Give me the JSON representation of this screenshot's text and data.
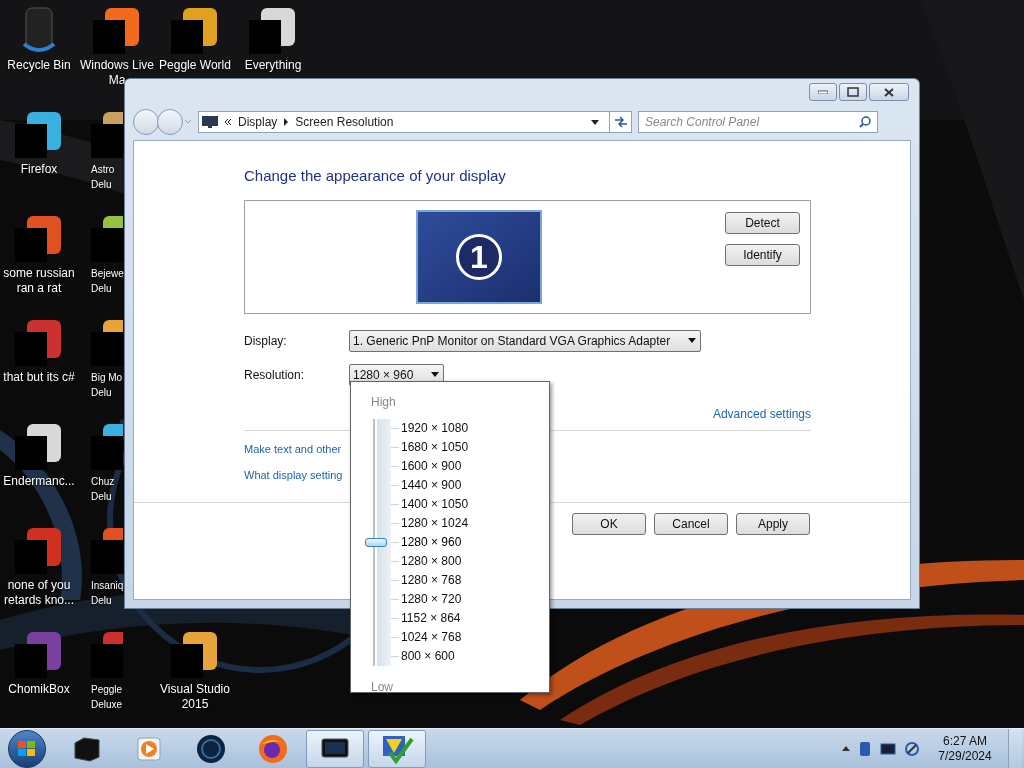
{
  "desktop_rows": [
    [
      {
        "label": "Recycle Bin",
        "kind": "bin"
      },
      {
        "label": "Windows Live Ma",
        "kind": "app"
      },
      {
        "label": "Peggle World",
        "kind": "app"
      },
      {
        "label": "Everything",
        "kind": "app"
      }
    ],
    [
      {
        "label": "Firefox",
        "kind": "app"
      },
      {
        "label": "Astro Delu",
        "kind": "app"
      }
    ],
    [
      {
        "label": "some russian ran a rat",
        "kind": "app"
      },
      {
        "label": "Bejewe Delu",
        "kind": "app"
      }
    ],
    [
      {
        "label": "that but its c#",
        "kind": "app"
      },
      {
        "label": "Big Mo Delu",
        "kind": "app"
      }
    ],
    [
      {
        "label": "Endermanc...",
        "kind": "app"
      },
      {
        "label": "Chuz Delu",
        "kind": "app"
      }
    ],
    [
      {
        "label": "none of you retards kno...",
        "kind": "app"
      },
      {
        "label": "Insaniq Delu",
        "kind": "app"
      }
    ],
    [
      {
        "label": "ChomikBox",
        "kind": "app"
      },
      {
        "label": "Peggle Deluxe",
        "kind": "app"
      },
      {
        "label": "Visual Studio 2015",
        "kind": "app"
      }
    ]
  ],
  "window": {
    "address_bar": {
      "crumbs": [
        "Display",
        "Screen Resolution"
      ]
    },
    "search": {
      "placeholder": "Search Control Panel"
    },
    "heading": "Change the appearance of your display",
    "monitor": {
      "number": "1"
    },
    "side_buttons": [
      "Detect",
      "Identify"
    ],
    "fields": [
      {
        "label": "Display:",
        "value": "1. Generic PnP Monitor on Standard VGA Graphics Adapter"
      },
      {
        "label": "Resolution:",
        "value": "1280 × 960"
      }
    ],
    "advanced_link": "Advanced settings",
    "links": [
      "Make text and other",
      "What display setting"
    ],
    "dialog_buttons": [
      "OK",
      "Cancel",
      "Apply"
    ]
  },
  "resolution_menu": {
    "high_label": "High",
    "low_label": "Low",
    "options": [
      {
        "label": "1920 × 1080",
        "selected": false
      },
      {
        "label": "1680 × 1050",
        "selected": false
      },
      {
        "label": "1600 × 900",
        "selected": false
      },
      {
        "label": "1440 × 900",
        "selected": false
      },
      {
        "label": "1400 × 1050",
        "selected": false
      },
      {
        "label": "1280 × 1024",
        "selected": false
      },
      {
        "label": "1280 × 960",
        "selected": true
      },
      {
        "label": "1280 × 800",
        "selected": false
      },
      {
        "label": "1280 × 768",
        "selected": false
      },
      {
        "label": "1280 × 720",
        "selected": false
      },
      {
        "label": "1152 × 864",
        "selected": false
      },
      {
        "label": "1024 × 768",
        "selected": false
      },
      {
        "label": "800 × 600",
        "selected": false
      }
    ]
  },
  "taskbar": {
    "items": [
      {
        "kind": "box",
        "running": false
      },
      {
        "kind": "player",
        "running": false
      },
      {
        "kind": "globe",
        "running": false
      },
      {
        "kind": "firefox",
        "running": false
      },
      {
        "kind": "monitor",
        "running": true
      },
      {
        "kind": "checkmark",
        "running": true
      }
    ],
    "clock": {
      "time": "6:27 AM",
      "date": "7/29/2024"
    }
  }
}
